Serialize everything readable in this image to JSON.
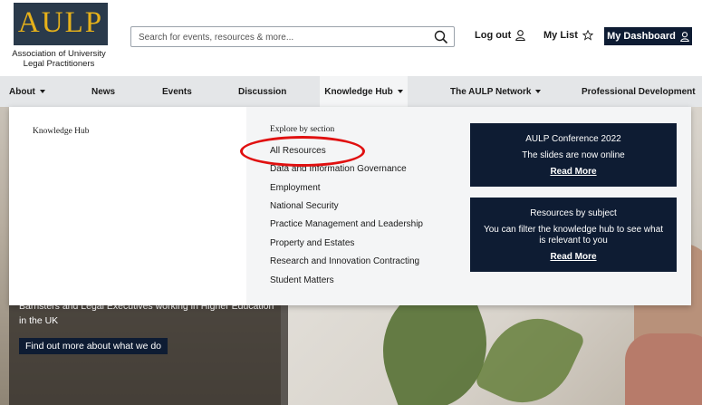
{
  "logo": {
    "text": "AULP",
    "caption": "Association of University Legal Practitioners"
  },
  "search": {
    "placeholder": "Search for events, resources & more..."
  },
  "account": {
    "logout_label": "Log out",
    "mylist_label": "My List",
    "dashboard_label": "My Dashboard"
  },
  "nav": {
    "items": [
      {
        "label": "About"
      },
      {
        "label": "News"
      },
      {
        "label": "Events"
      },
      {
        "label": "Discussion"
      },
      {
        "label": "Knowledge Hub"
      },
      {
        "label": "The AULP Network"
      },
      {
        "label": "Professional Development"
      }
    ]
  },
  "mega_menu": {
    "left_title": "Knowledge Hub",
    "section_title": "Explore by section",
    "links": [
      {
        "label": "All Resources"
      },
      {
        "label": "Data and Information Governance"
      },
      {
        "label": "Employment"
      },
      {
        "label": "National Security"
      },
      {
        "label": "Practice Management and Leadership"
      },
      {
        "label": "Property and Estates"
      },
      {
        "label": "Research and Innovation Contracting"
      },
      {
        "label": "Student Matters"
      }
    ],
    "promos": [
      {
        "title": "AULP Conference 2022",
        "body": "The slides are now online",
        "link": "Read More"
      },
      {
        "title": "Resources by subject",
        "body": "You can filter the knowledge hub to see what is relevant to you",
        "link": "Read More"
      }
    ]
  },
  "hero": {
    "text": "Barristers and Legal Executives working in Higher Education in the UK",
    "button_label": "Find out more about what we do"
  },
  "colors": {
    "brand_navy": "#0e1c33",
    "logo_gold": "#e6b11a",
    "highlight_red": "#e01010"
  }
}
